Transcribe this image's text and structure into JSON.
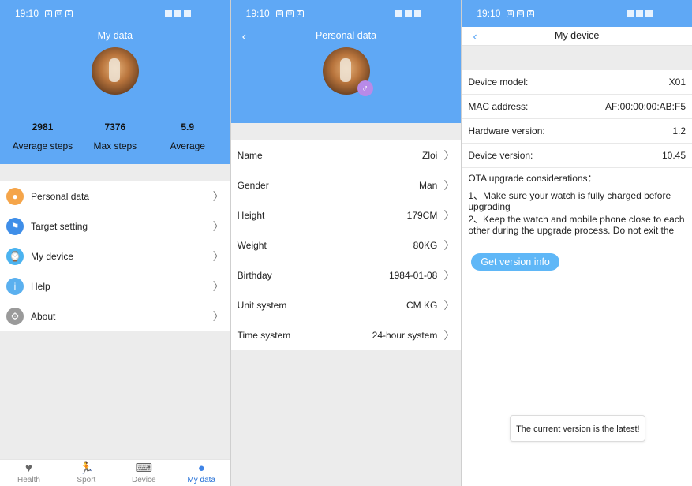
{
  "status_bar": {
    "time": "19:10",
    "icons": [
      "⊞",
      "✉",
      "Σ"
    ]
  },
  "screen1": {
    "title": "My data",
    "stats": [
      {
        "value": "2981",
        "label": "Average steps"
      },
      {
        "value": "7376",
        "label": "Max steps"
      },
      {
        "value": "5.9",
        "label": "Average"
      }
    ],
    "menu": [
      {
        "label": "Personal data",
        "icon": "person-icon",
        "color": "#f5a54a"
      },
      {
        "label": "Target setting",
        "icon": "flag-icon",
        "color": "#3f8ee8"
      },
      {
        "label": "My device",
        "icon": "watch-icon",
        "color": "#4bb3f0"
      },
      {
        "label": "Help",
        "icon": "info-icon",
        "color": "#5bb0ef"
      },
      {
        "label": "About",
        "icon": "gear-icon",
        "color": "#9a9a9a"
      }
    ],
    "nav": [
      {
        "label": "Health",
        "icon": "heart-icon"
      },
      {
        "label": "Sport",
        "icon": "runner-icon"
      },
      {
        "label": "Device",
        "icon": "device-icon"
      },
      {
        "label": "My data",
        "icon": "person-icon",
        "active": true
      }
    ]
  },
  "screen2": {
    "title": "Personal data",
    "gender_symbol": "♂",
    "rows": [
      {
        "label": "Name",
        "value": "Zloi"
      },
      {
        "label": "Gender",
        "value": "Man"
      },
      {
        "label": "Height",
        "value": "179CM"
      },
      {
        "label": "Weight",
        "value": "80KG"
      },
      {
        "label": "Birthday",
        "value": "1984-01-08"
      },
      {
        "label": "Unit system",
        "value": "CM KG"
      },
      {
        "label": "Time system",
        "value": "24-hour system"
      }
    ]
  },
  "screen3": {
    "title": "My device",
    "rows": [
      {
        "label": "Device model:",
        "value": "X01"
      },
      {
        "label": "MAC address:",
        "value": "AF:00:00:00:AB:F5"
      },
      {
        "label": "Hardware version:",
        "value": "1.2"
      },
      {
        "label": "Device version:",
        "value": "10.45"
      }
    ],
    "ota_heading": "OTA upgrade considerations：",
    "ota_line1": "1、Make sure your watch is fully charged before upgrading",
    "ota_line2": "2、Keep the watch and mobile phone close to each other during the upgrade process. Do not exit the",
    "button_label": "Get version info",
    "toast": "The current version is the latest!"
  }
}
